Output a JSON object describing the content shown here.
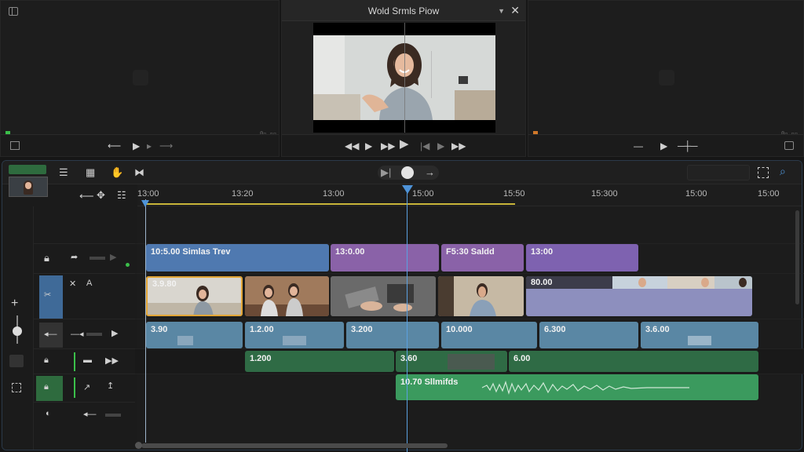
{
  "viewer": {
    "title": "Wold Srmls Piow"
  },
  "timeline": {
    "ruler_ticks": [
      "13:00",
      "13:20",
      "13:00",
      "15:00",
      "15:50",
      "15:300",
      "15:00",
      "15:00"
    ],
    "rows": {
      "v3": [
        {
          "label": "10:5.00 Simlas Trev",
          "color": "#4f79b0"
        },
        {
          "label": "13:0.00",
          "color": "#8a62a8"
        },
        {
          "label": "F5:30 Saldd",
          "color": "#8a62a8"
        },
        {
          "label": "13:00",
          "color": "#7e62b0"
        }
      ],
      "v2_label": "3.9.80",
      "v2_tail_label": "80.00",
      "v1": [
        {
          "label": "3.90"
        },
        {
          "label": "1.2.00"
        },
        {
          "label": "3.200"
        },
        {
          "label": "10.000"
        },
        {
          "label": "6.300"
        },
        {
          "label": "3.6.00"
        }
      ],
      "a1": [
        {
          "label": "1.200"
        },
        {
          "label": "3.60"
        },
        {
          "label": "6.00"
        }
      ],
      "a2": {
        "label": "10.70 Sllmifds"
      }
    }
  },
  "icons": {
    "panel_grid": "layout-icon",
    "close": "close-icon",
    "search": "search-icon"
  },
  "colors": {
    "accent": "#4e93d8",
    "work_range": "#c9b63a"
  }
}
